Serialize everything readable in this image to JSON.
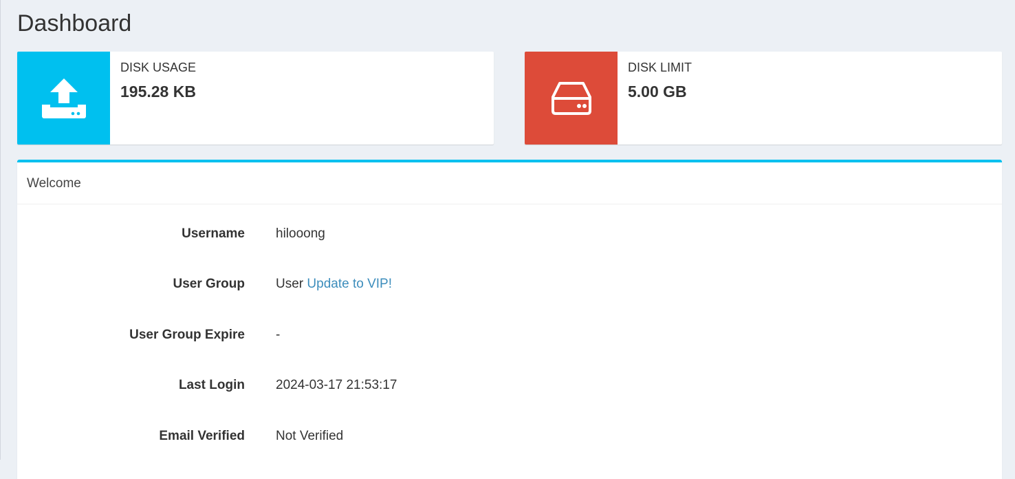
{
  "page": {
    "title": "Dashboard"
  },
  "stats": {
    "disk_usage": {
      "label": "DISK USAGE",
      "value": "195.28 KB",
      "icon": "upload-icon",
      "color": "#00c0ef"
    },
    "disk_limit": {
      "label": "DISK LIMIT",
      "value": "5.00 GB",
      "icon": "hard-drive-icon",
      "color": "#dd4b39"
    }
  },
  "welcome": {
    "title": "Welcome",
    "accent": "#00c0ef",
    "rows": {
      "username": {
        "key": "Username",
        "value": "hilooong"
      },
      "user_group": {
        "key": "User Group",
        "value": "User",
        "link": "Update to VIP!",
        "link_color": "#3c8dbc"
      },
      "user_group_expire": {
        "key": "User Group Expire",
        "value": "-"
      },
      "last_login": {
        "key": "Last Login",
        "value": "2024-03-17 21:53:17"
      },
      "email_verified": {
        "key": "Email Verified",
        "value": "Not Verified"
      }
    }
  }
}
